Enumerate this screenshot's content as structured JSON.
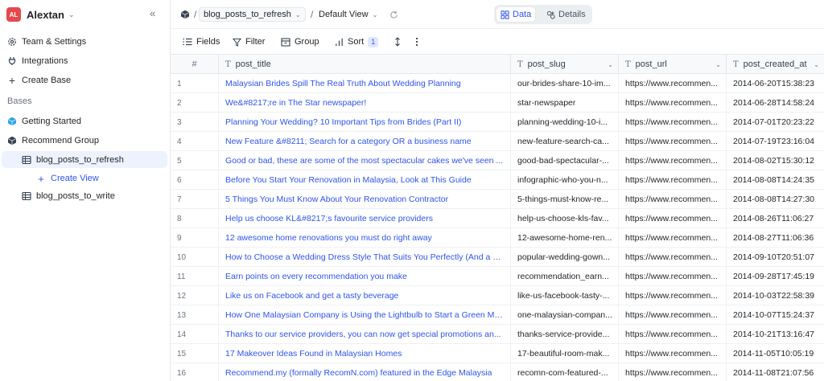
{
  "workspace": {
    "badge": "AL",
    "name": "Alextan"
  },
  "sidebar": {
    "items": [
      {
        "label": "Team & Settings"
      },
      {
        "label": "Integrations"
      },
      {
        "label": "Create Base"
      }
    ],
    "section_label": "Bases",
    "bases": [
      {
        "label": "Getting Started",
        "color": "#2ea5e8"
      },
      {
        "label": "Recommend Group",
        "color": "#374151"
      }
    ],
    "tables": [
      {
        "label": "blog_posts_to_refresh",
        "active": true
      },
      {
        "label": "blog_posts_to_write",
        "active": false
      }
    ],
    "create_view_label": "Create View"
  },
  "breadcrumb": {
    "table": "blog_posts_to_refresh",
    "view": "Default View"
  },
  "view_toggle": {
    "data_label": "Data",
    "details_label": "Details",
    "accent": "#2f54eb"
  },
  "toolbar": {
    "fields_label": "Fields",
    "filter_label": "Filter",
    "group_label": "Group",
    "sort_label": "Sort",
    "sort_count": "1"
  },
  "grid": {
    "columns": [
      {
        "label": "#"
      },
      {
        "label": "post_title"
      },
      {
        "label": "post_slug"
      },
      {
        "label": "post_url"
      },
      {
        "label": "post_created_at"
      }
    ],
    "rows": [
      {
        "n": "1",
        "title": "Malaysian Brides Spill The Real Truth About Wedding Planning",
        "slug": "our-brides-share-10-im...",
        "url": "https://www.recommen...",
        "date": "2014-06-20T15:38:23"
      },
      {
        "n": "2",
        "title": "We&#8217;re in The Star newspaper!",
        "slug": "star-newspaper",
        "url": "https://www.recommen...",
        "date": "2014-06-28T14:58:24"
      },
      {
        "n": "3",
        "title": "Planning Your Wedding? 10 Important Tips from Brides (Part II)",
        "slug": "planning-wedding-10-i...",
        "url": "https://www.recommen...",
        "date": "2014-07-01T20:23:22"
      },
      {
        "n": "4",
        "title": "New Feature &#8211; Search for a category OR a business name",
        "slug": "new-feature-search-ca...",
        "url": "https://www.recommen...",
        "date": "2014-07-19T23:16:04"
      },
      {
        "n": "5",
        "title": "Good or bad, these are some of the most spectacular cakes we've seen ...",
        "slug": "good-bad-spectacular-...",
        "url": "https://www.recommen...",
        "date": "2014-08-02T15:30:12"
      },
      {
        "n": "6",
        "title": "Before You Start Your Renovation in Malaysia, Look at This Guide",
        "slug": "infographic-who-you-n...",
        "url": "https://www.recommen...",
        "date": "2014-08-08T14:24:35"
      },
      {
        "n": "7",
        "title": "5 Things You Must Know About Your Renovation Contractor",
        "slug": "5-things-must-know-re...",
        "url": "https://www.recommen...",
        "date": "2014-08-08T14:27:30"
      },
      {
        "n": "8",
        "title": "Help us choose KL&#8217;s favourite service providers",
        "slug": "help-us-choose-kls-fav...",
        "url": "https://www.recommen...",
        "date": "2014-08-26T11:06:27"
      },
      {
        "n": "9",
        "title": "12 awesome home renovations you must do right away",
        "slug": "12-awesome-home-ren...",
        "url": "https://www.recommen...",
        "date": "2014-08-27T11:06:36"
      },
      {
        "n": "10",
        "title": "How to Choose a Wedding Dress Style That Suits You Perfectly (And a D...",
        "slug": "popular-wedding-gown...",
        "url": "https://www.recommen...",
        "date": "2014-09-10T20:51:07"
      },
      {
        "n": "11",
        "title": "Earn points on every recommendation you make",
        "slug": "recommendation_earn...",
        "url": "https://www.recommen...",
        "date": "2014-09-28T17:45:19"
      },
      {
        "n": "12",
        "title": "Like us on Facebook and get a tasty beverage",
        "slug": "like-us-facebook-tasty-...",
        "url": "https://www.recommen...",
        "date": "2014-10-03T22:58:39"
      },
      {
        "n": "13",
        "title": "How One Malaysian Company is Using the Lightbulb to Start a Green Mo...",
        "slug": "one-malaysian-compan...",
        "url": "https://www.recommen...",
        "date": "2014-10-07T15:24:37"
      },
      {
        "n": "14",
        "title": "Thanks to our service providers, you can now get special promotions an...",
        "slug": "thanks-service-provide...",
        "url": "https://www.recommen...",
        "date": "2014-10-21T13:16:47"
      },
      {
        "n": "15",
        "title": "17 Makeover Ideas Found in Malaysian Homes",
        "slug": "17-beautiful-room-mak...",
        "url": "https://www.recommen...",
        "date": "2014-11-05T10:05:19"
      },
      {
        "n": "16",
        "title": "Recommend.my (formally RecomN.com) featured in the Edge Malaysia",
        "slug": "recomn-com-featured-...",
        "url": "https://www.recommen...",
        "date": "2014-11-08T21:07:56"
      }
    ]
  }
}
